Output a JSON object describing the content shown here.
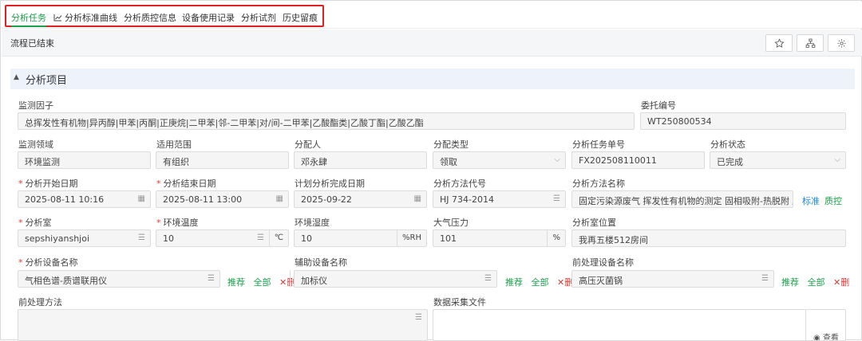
{
  "tabs": {
    "items": [
      "分析任务",
      "分析标准曲线",
      "分析质控信息",
      "设备使用记录",
      "分析试剂",
      "历史留痕"
    ],
    "active_index": 0
  },
  "toolbar": {
    "status": "流程已结束",
    "buttons": [
      "star-icon",
      "sitemap-icon",
      "gear-icon"
    ]
  },
  "section": {
    "title": "分析项目"
  },
  "form": {
    "factor": {
      "label": "监测因子",
      "value": "总挥发性有机物|异丙醇|甲苯|丙酮|正庚烷|二甲苯|邻-二甲苯|对/间-二甲苯|乙酸酯类|乙酸丁酯|乙酸乙酯"
    },
    "commission": {
      "label": "委托编号",
      "value": "WT250800534"
    },
    "domain": {
      "label": "监测领域",
      "value": "环境监测"
    },
    "scope": {
      "label": "适用范围",
      "value": "有组织"
    },
    "assignee": {
      "label": "分配人",
      "value": "邓永肆"
    },
    "assign_type": {
      "label": "分配类型",
      "value": "领取"
    },
    "task_no": {
      "label": "分析任务单号",
      "value": "FX202508110011"
    },
    "state": {
      "label": "分析状态",
      "value": "已完成"
    },
    "start_date": {
      "label": "分析开始日期",
      "value": "2025-08-11 10:16"
    },
    "end_date": {
      "label": "分析结束日期",
      "value": "2025-08-11 13:00"
    },
    "plan_date": {
      "label": "计划分析完成日期",
      "value": "2025-09-22"
    },
    "method_code": {
      "label": "分析方法代号",
      "value": "HJ 734-2014"
    },
    "method_name": {
      "label": "分析方法名称",
      "value": "固定污染源废气 挥发性有机物的测定 固相吸附-热脱附 / 气",
      "link1": "标准",
      "link2": "质控"
    },
    "room": {
      "label": "分析室",
      "value": "sepshiyanshjoi"
    },
    "temperature": {
      "label": "环境温度",
      "value": "10",
      "unit": "℃"
    },
    "humidity": {
      "label": "环境湿度",
      "value": "10",
      "unit": "%RH"
    },
    "pressure": {
      "label": "大气压力",
      "value": "101",
      "unit": "%"
    },
    "room_location": {
      "label": "分析室位置",
      "value": "我再五楼512房间"
    },
    "device": {
      "label": "分析设备名称",
      "value": "气相色谱-质谱联用仪"
    },
    "aux_device": {
      "label": "辅助设备名称",
      "value": "加标仪"
    },
    "pre_device": {
      "label": "前处理设备名称",
      "value": "高压灭菌锅"
    },
    "pre_method": {
      "label": "前处理方法",
      "value": ""
    },
    "data_file": {
      "label": "数据采集文件",
      "view": "查看"
    }
  },
  "actions": {
    "recommend": "推荐",
    "all": "全部",
    "delete": "删"
  },
  "colors": {
    "accent": "#19a04a",
    "required": "#e53935",
    "link_blue": "#1e88e5",
    "section_bg": "#eef2fa",
    "tab_highlight_border": "#e02020"
  }
}
